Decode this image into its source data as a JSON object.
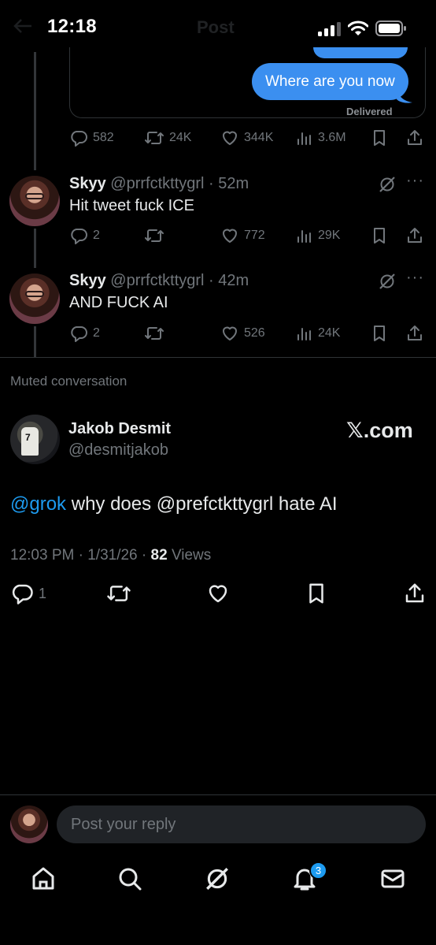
{
  "status_bar": {
    "time": "12:18"
  },
  "ghost_header": {
    "title": "Post"
  },
  "dm": {
    "message": "Where are you now",
    "status": "Delivered"
  },
  "parent_post_stats": {
    "replies": "582",
    "reposts": "24K",
    "likes": "344K",
    "views": "3.6M"
  },
  "replies": [
    {
      "name": "Skyy",
      "handle": "@prrfctkttygrl",
      "time": "52m",
      "text": "Hit tweet fuck ICE",
      "replies": "2",
      "reposts": "",
      "likes": "772",
      "views": "29K"
    },
    {
      "name": "Skyy",
      "handle": "@prrfctkttygrl",
      "time": "42m",
      "text": "AND FUCK AI",
      "replies": "2",
      "reposts": "",
      "likes": "526",
      "views": "24K"
    }
  ],
  "muted_label": "Muted conversation",
  "main_post": {
    "name": "Jakob Desmit",
    "handle": "@desmitjakob",
    "source_logo": "𝕏.com",
    "mention": "@grok",
    "text": " why does @prefctkttygrl hate AI",
    "time": "12:03 PM",
    "date": "1/31/26",
    "views_count": "82",
    "views_label": "Views",
    "replies": "1"
  },
  "reply_input": {
    "placeholder": "Post your reply"
  },
  "tab_bar": {
    "notifications_badge": "3"
  },
  "colors": {
    "accent": "#1d9bf0",
    "bubble": "#3b8ff0",
    "background": "#000000",
    "muted_text": "#71767b"
  },
  "icons": [
    "comment-icon",
    "repost-icon",
    "like-icon",
    "views-icon",
    "bookmark-icon",
    "share-icon",
    "grok-icon",
    "more-icon",
    "home-icon",
    "search-icon",
    "notifications-icon",
    "messages-icon"
  ]
}
